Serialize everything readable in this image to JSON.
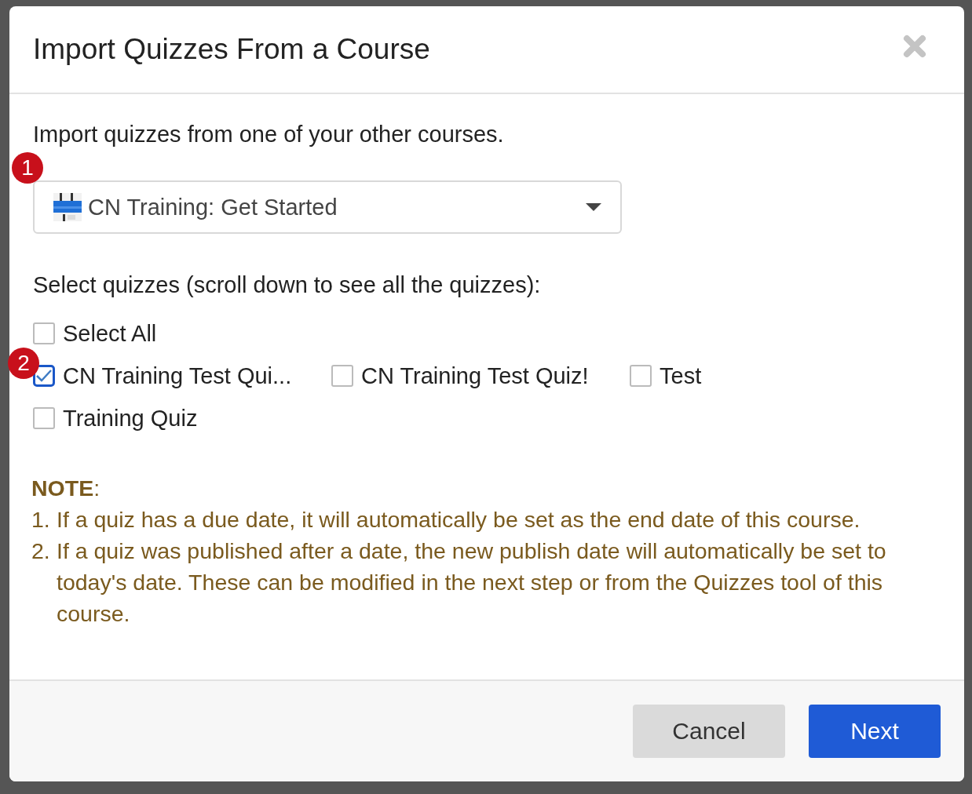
{
  "dialog": {
    "title": "Import Quizzes From a Course",
    "intro": "Import quizzes from one of your other courses.",
    "course_select": {
      "value": "CN Training: Get Started"
    },
    "quizzes_label": "Select quizzes (scroll down to see all the quizzes):",
    "select_all": {
      "label": "Select All",
      "checked": false
    },
    "quizzes": [
      {
        "label": "CN Training Test Qui...",
        "checked": true
      },
      {
        "label": "CN Training Test Quiz!",
        "checked": false
      },
      {
        "label": "Test",
        "checked": false
      },
      {
        "label": "Training Quiz",
        "checked": false
      }
    ],
    "note": {
      "heading": "**NOTE**:",
      "items": [
        {
          "number": "1.",
          "text": "If a quiz has a due date, it will automatically be set as the end date of this course."
        },
        {
          "number": "2.",
          "text": "If a quiz was published after a date, the new publish date will automatically be set to today's date. These can be modified in the next step or from the Quizzes tool of this course."
        }
      ]
    },
    "buttons": [
      {
        "label": "Cancel",
        "kind": "secondary"
      },
      {
        "label": "Next",
        "kind": "primary"
      }
    ]
  },
  "annotations": [
    {
      "label": "1"
    },
    {
      "label": "2"
    }
  ]
}
